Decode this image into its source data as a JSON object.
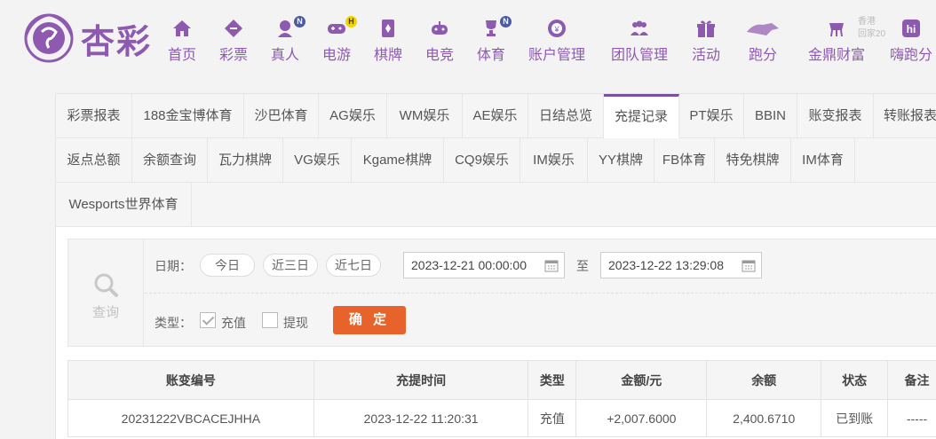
{
  "brand": {
    "name": "杏彩"
  },
  "nav": [
    {
      "label": "首页",
      "icon": "home-icon",
      "badge": ""
    },
    {
      "label": "彩票",
      "icon": "lottery-icon",
      "badge": ""
    },
    {
      "label": "真人",
      "icon": "live-dealer-icon",
      "badge": "N"
    },
    {
      "label": "电游",
      "icon": "gamepad-icon",
      "badge": "H"
    },
    {
      "label": "棋牌",
      "icon": "cards-icon",
      "badge": ""
    },
    {
      "label": "电竞",
      "icon": "esports-icon",
      "badge": ""
    },
    {
      "label": "体育",
      "icon": "trophy-icon",
      "badge": "N"
    },
    {
      "label": "账户管理",
      "icon": "account-icon",
      "badge": ""
    },
    {
      "label": "团队管理",
      "icon": "team-icon",
      "badge": ""
    },
    {
      "label": "活动",
      "icon": "gift-icon",
      "badge": ""
    },
    {
      "label": "跑分",
      "icon": "run-score-icon",
      "badge": ""
    },
    {
      "label": "金鼎财富",
      "icon": "wealth-icon",
      "badge": ""
    },
    {
      "label": "嗨跑分",
      "icon": "hi-run-icon",
      "badge": ""
    }
  ],
  "watermark": {
    "line1": "香港",
    "line2": "回家20",
    "line3": "hi"
  },
  "tabs_row1": [
    "彩票报表",
    "188金宝博体育",
    "沙巴体育",
    "AG娱乐",
    "WM娱乐",
    "AE娱乐",
    "日结总览",
    "充提记录",
    "PT娱乐",
    "BBIN",
    "账变报表",
    "转账报表"
  ],
  "tabs_row2": [
    "返点总额",
    "余额查询",
    "瓦力棋牌",
    "VG娱乐",
    "Kgame棋牌",
    "CQ9娱乐",
    "IM娱乐",
    "YY棋牌",
    "FB体育",
    "特免棋牌",
    "IM体育"
  ],
  "tabs_row3": [
    "Wesports世界体育"
  ],
  "active_tab": "充提记录",
  "query": {
    "side_label": "查询",
    "date_label": "日期：",
    "quick_ranges": [
      "今日",
      "近三日",
      "近七日"
    ],
    "start": "2023-12-21 00:00:00",
    "to_label": "至",
    "end": "2023-12-22 13:29:08",
    "type_label": "类型：",
    "types": [
      {
        "label": "充值",
        "checked": true
      },
      {
        "label": "提现",
        "checked": false
      }
    ],
    "confirm": "确 定"
  },
  "table": {
    "headers": [
      "账变编号",
      "充提时间",
      "类型",
      "金额/元",
      "余额",
      "状态",
      "备注"
    ],
    "rows": [
      {
        "id": "20231222VBCACEJHHA",
        "time": "2023-12-22 11:20:31",
        "type": "充值",
        "amount": "+2,007.6000",
        "balance": "2,400.6710",
        "status": "已到账",
        "note": "-----"
      }
    ]
  },
  "colors": {
    "brand": "#8e5ab0",
    "accent": "#e8632c",
    "amount": "#d9342b",
    "status_ok": "#3aa63a"
  }
}
